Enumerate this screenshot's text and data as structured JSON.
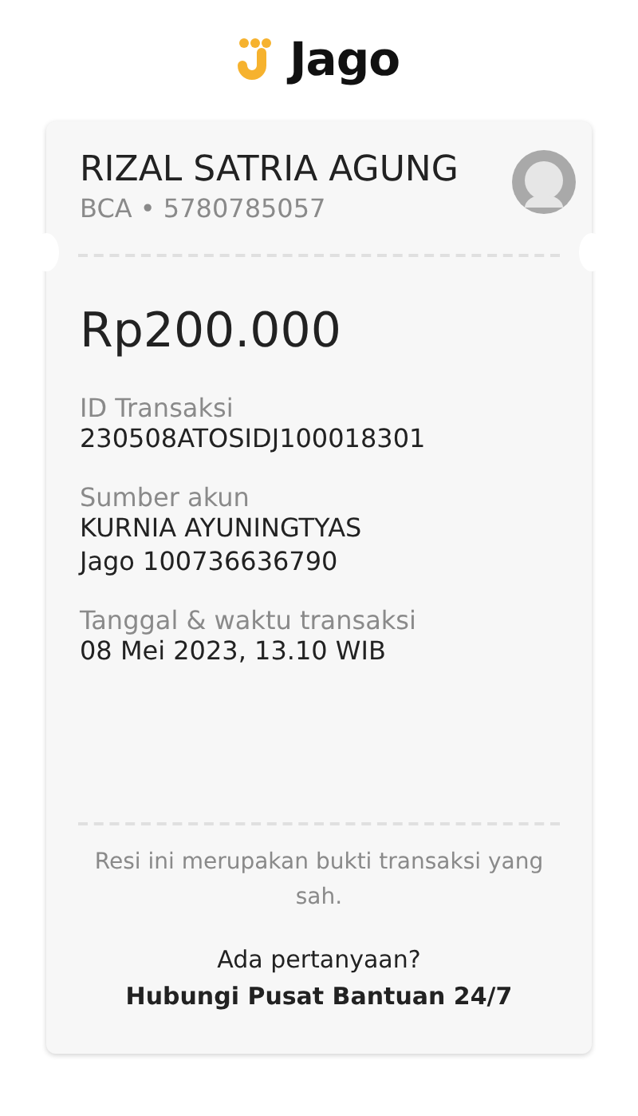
{
  "logo": {
    "text": "Jago"
  },
  "recipient": {
    "name": "RIZAL SATRIA AGUNG",
    "account": "BCA • 5780785057"
  },
  "amount": "Rp200.000",
  "fields": [
    {
      "label": "ID Transaksi",
      "values": [
        "230508ATOSIDJ100018301"
      ]
    },
    {
      "label": "Sumber akun",
      "values": [
        "KURNIA AYUNINGTYAS",
        "Jago 100736636790"
      ]
    },
    {
      "label": "Tanggal & waktu transaksi",
      "values": [
        "08 Mei 2023, 13.10 WIB"
      ]
    }
  ],
  "footer": {
    "note": "Resi ini merupakan bukti transaksi yang sah.",
    "question": "Ada pertanyaan?",
    "link": "Hubungi Pusat Bantuan 24/7"
  }
}
